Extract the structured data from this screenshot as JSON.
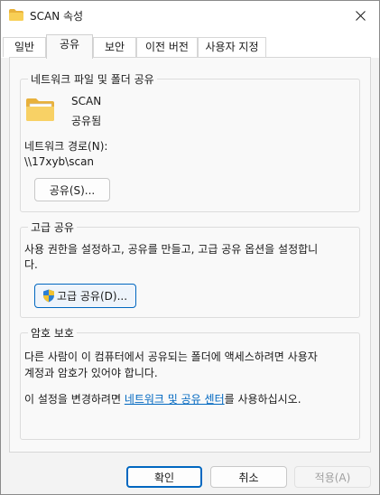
{
  "window": {
    "title": "SCAN 속성"
  },
  "tabs": [
    {
      "label": "일반"
    },
    {
      "label": "공유"
    },
    {
      "label": "보안"
    },
    {
      "label": "이전 버전"
    },
    {
      "label": "사용자 지정"
    }
  ],
  "network_share": {
    "group_title": "네트워크 파일 및 폴더 공유",
    "folder_name": "SCAN",
    "share_status": "공유됨",
    "path_label": "네트워크 경로(N):",
    "path_value": "\\\\17xyb\\scan",
    "share_button": "공유(S)..."
  },
  "advanced_share": {
    "group_title": "고급 공유",
    "description_line1": "사용 권한을 설정하고, 공유를 만들고, 고급 공유 옵션을 설정합니",
    "description_line2": "다.",
    "button": "고급 공유(D)..."
  },
  "password_protection": {
    "group_title": "암호 보호",
    "description_line1": "다른 사람이 이 컴퓨터에서 공유되는 폴더에 액세스하려면 사용자",
    "description_line2": "계정과 암호가 있어야 합니다.",
    "change_prefix": "이 설정을 변경하려면 ",
    "link_text": "네트워크 및 공유 센터",
    "change_suffix": "를 사용하십시오."
  },
  "footer": {
    "ok": "확인",
    "cancel": "취소",
    "apply": "적용(A)"
  },
  "colors": {
    "accent": "#0067c0",
    "folder": "#f5c542"
  }
}
